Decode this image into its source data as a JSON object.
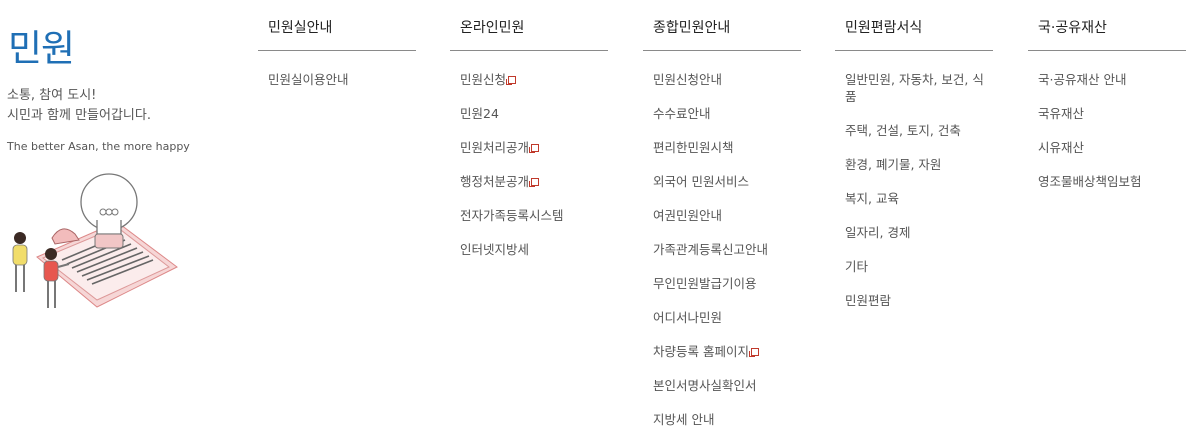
{
  "intro": {
    "title": "민원",
    "slogan_line1": "소통, 참여 도시!",
    "slogan_line2": "시민과 함께 만들어갑니다.",
    "english": "The better Asan, the more happy"
  },
  "colors": {
    "accent": "#1f6fb5",
    "external_icon": "#c0392b"
  },
  "columns": [
    {
      "heading": "민원실안내",
      "items": [
        {
          "label": "민원실이용안내",
          "external": false
        }
      ]
    },
    {
      "heading": "온라인민원",
      "items": [
        {
          "label": "민원신청",
          "external": true
        },
        {
          "label": "민원24",
          "external": false
        },
        {
          "label": "민원처리공개",
          "external": true
        },
        {
          "label": "행정처분공개",
          "external": true
        },
        {
          "label": "전자가족등록시스템",
          "external": false
        },
        {
          "label": "인터넷지방세",
          "external": false
        }
      ]
    },
    {
      "heading": "종합민원안내",
      "items": [
        {
          "label": "민원신청안내",
          "external": false
        },
        {
          "label": "수수료안내",
          "external": false
        },
        {
          "label": "편리한민원시책",
          "external": false
        },
        {
          "label": "외국어 민원서비스",
          "external": false
        },
        {
          "label": "여권민원안내",
          "external": false
        },
        {
          "label": "가족관계등록신고안내",
          "external": false
        },
        {
          "label": "무인민원발급기이용",
          "external": false
        },
        {
          "label": "어디서나민원",
          "external": false
        },
        {
          "label": "차량등록 홈페이지",
          "external": true
        },
        {
          "label": "본인서명사실확인서",
          "external": false
        },
        {
          "label": "지방세 안내",
          "external": false
        }
      ]
    },
    {
      "heading": "민원편람서식",
      "items": [
        {
          "label": "일반민원, 자동차, 보건, 식품",
          "external": false
        },
        {
          "label": "주택, 건설, 토지, 건축",
          "external": false
        },
        {
          "label": "환경, 폐기물, 자원",
          "external": false
        },
        {
          "label": "복지, 교육",
          "external": false
        },
        {
          "label": "일자리, 경제",
          "external": false
        },
        {
          "label": "기타",
          "external": false
        },
        {
          "label": "민원편람",
          "external": false
        }
      ]
    },
    {
      "heading": "국·공유재산",
      "items": [
        {
          "label": "국·공유재산 안내",
          "external": false
        },
        {
          "label": "국유재산",
          "external": false
        },
        {
          "label": "시유재산",
          "external": false
        },
        {
          "label": "영조물배상책임보험",
          "external": false
        }
      ]
    }
  ]
}
